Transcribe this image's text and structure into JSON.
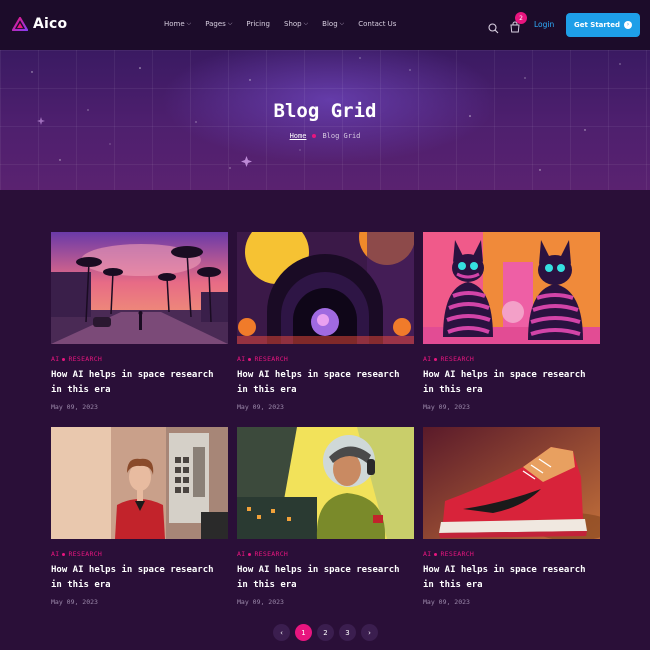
{
  "header": {
    "logo_text": "Aico",
    "nav": [
      {
        "label": "Home",
        "has_dropdown": true
      },
      {
        "label": "Pages",
        "has_dropdown": true
      },
      {
        "label": "Pricing",
        "has_dropdown": false
      },
      {
        "label": "Shop",
        "has_dropdown": true
      },
      {
        "label": "Blog",
        "has_dropdown": true
      },
      {
        "label": "Contact Us",
        "has_dropdown": false
      }
    ],
    "cart_count": "2",
    "login_label": "Login",
    "cta_label": "Get Started"
  },
  "hero": {
    "title": "Blog Grid",
    "breadcrumb": {
      "home": "Home",
      "current": "Blog Grid"
    }
  },
  "posts": [
    {
      "category_a": "AI",
      "category_b": "RESEARCH",
      "title": "How AI helps in space research in this era",
      "date": "May 09, 2023",
      "image": "synthwave-street-palms"
    },
    {
      "category_a": "AI",
      "category_b": "RESEARCH",
      "title": "How AI helps in space research in this era",
      "date": "May 09, 2023",
      "image": "retro-portal-orbs"
    },
    {
      "category_a": "AI",
      "category_b": "RESEARCH",
      "title": "How AI helps in space research in this era",
      "date": "May 09, 2023",
      "image": "striped-cats"
    },
    {
      "category_a": "AI",
      "category_b": "RESEARCH",
      "title": "How AI helps in space research in this era",
      "date": "May 09, 2023",
      "image": "woman-red-jacket-retro-machine"
    },
    {
      "category_a": "AI",
      "category_b": "RESEARCH",
      "title": "How AI helps in space research in this era",
      "date": "May 09, 2023",
      "image": "astronaut-pilot"
    },
    {
      "category_a": "AI",
      "category_b": "RESEARCH",
      "title": "How AI helps in space research in this era",
      "date": "May 09, 2023",
      "image": "red-sneaker"
    }
  ],
  "pagination": {
    "prev": "‹",
    "pages": [
      "1",
      "2",
      "3"
    ],
    "current": "1",
    "next": "›"
  },
  "colors": {
    "accent": "#e8157f",
    "cta": "#1e9fe8",
    "link": "#2fb0ff",
    "background": "#2a0f38"
  }
}
